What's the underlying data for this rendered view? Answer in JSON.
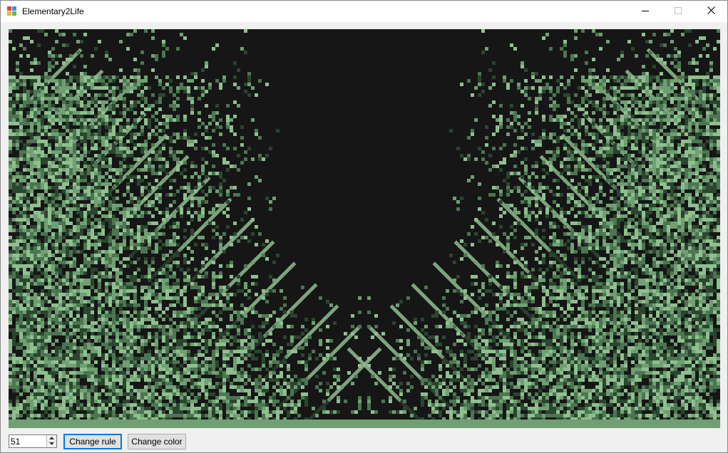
{
  "window": {
    "title": "Elementary2Life",
    "icon": "app-window-icon",
    "controls": [
      "minimize-icon",
      "maximize-icon",
      "close-icon"
    ]
  },
  "canvas": {
    "background_color": "#161616",
    "palette": [
      "#8fbf8f",
      "#6f9f72",
      "#4c7551",
      "#2b452f",
      "#1c2a1e"
    ]
  },
  "controls": {
    "rule_value": "51",
    "change_rule_label": "Change rule",
    "change_color_label": "Change color"
  },
  "colors": {
    "accent": "#0078d7",
    "button_face": "#e1e1e1",
    "window_bg": "#f0f0f0"
  }
}
